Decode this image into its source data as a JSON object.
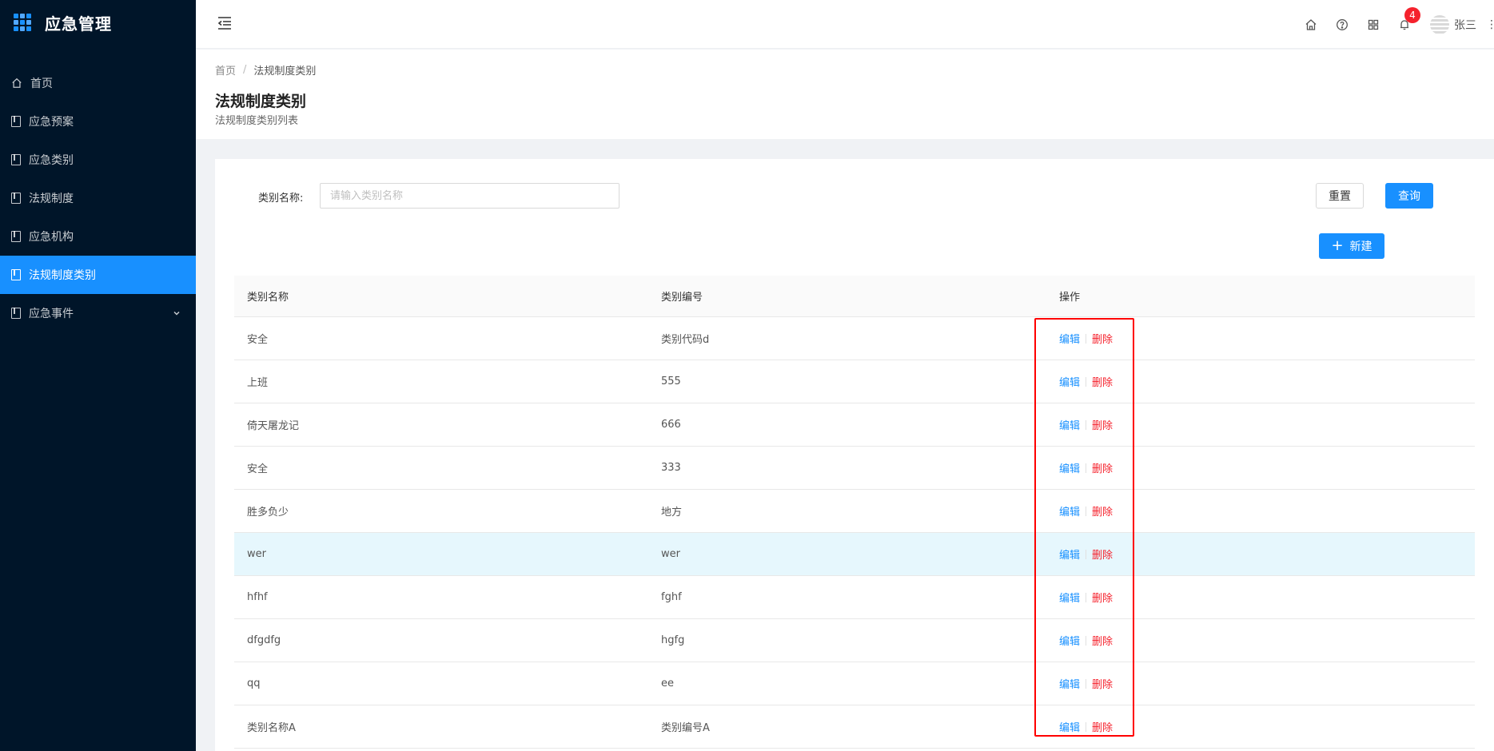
{
  "app": {
    "title": "应急管理"
  },
  "sidebar": {
    "items": [
      {
        "label": "首页",
        "icon": "home-icon",
        "active": false
      },
      {
        "label": "应急预案",
        "icon": "file-icon",
        "active": false
      },
      {
        "label": "应急类别",
        "icon": "file-icon",
        "active": false
      },
      {
        "label": "法规制度",
        "icon": "file-icon",
        "active": false
      },
      {
        "label": "应急机构",
        "icon": "file-icon",
        "active": false
      },
      {
        "label": "法规制度类别",
        "icon": "file-icon",
        "active": true
      },
      {
        "label": "应急事件",
        "icon": "file-icon",
        "active": false,
        "has_submenu": true
      }
    ]
  },
  "header": {
    "notification_count": "4",
    "username": "张三",
    "more": "⋮"
  },
  "breadcrumb": {
    "home": "首页",
    "separator": "/",
    "current": "法规制度类别"
  },
  "page": {
    "title": "法规制度类别",
    "subtitle": "法规制度类别列表"
  },
  "filter": {
    "label": "类别名称:",
    "placeholder": "请输入类别名称",
    "value": "",
    "reset_label": "重置",
    "query_label": "查询",
    "new_label": "新建",
    "new_icon": "+"
  },
  "table": {
    "headers": [
      "类别名称",
      "类别编号",
      "操作"
    ],
    "edit_label": "编辑",
    "delete_label": "删除",
    "rows": [
      {
        "name": "安全",
        "code": "类别代码d"
      },
      {
        "name": "上班",
        "code": "555"
      },
      {
        "name": "倚天屠龙记",
        "code": "666"
      },
      {
        "name": "安全",
        "code": "333"
      },
      {
        "name": "胜多负少",
        "code": "地方"
      },
      {
        "name": "wer",
        "code": "wer",
        "highlighted": true
      },
      {
        "name": "hfhf",
        "code": "fghf"
      },
      {
        "name": "dfgdfg",
        "code": "hgfg"
      },
      {
        "name": "qq",
        "code": "ee"
      },
      {
        "name": "类别名称A",
        "code": "类别编号A"
      }
    ]
  },
  "colors": {
    "sidebar_bg": "#001529",
    "primary": "#1890ff",
    "danger": "#f5222d",
    "annotation_box": "#ff0000"
  }
}
